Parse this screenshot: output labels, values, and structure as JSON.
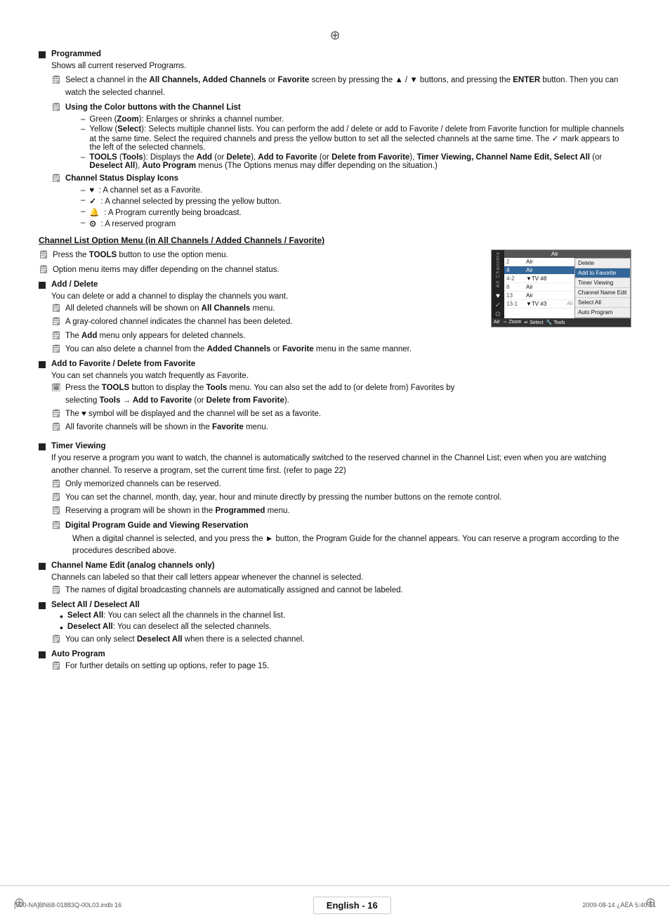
{
  "page": {
    "top_symbol": "⊕",
    "footer": {
      "left": "[500-NA]BN68-01883Q-00L03.indb   16",
      "center": "English - 16",
      "right": "2009-08-14   ¿ÁÈÀ 5:40:51"
    }
  },
  "sections": [
    {
      "id": "programmed",
      "bullet": true,
      "title": "Programmed",
      "body_lines": [
        "Shows all current reserved Programs."
      ],
      "notes": [
        "Select a channel in the <b>All Channels, Added Channels</b> or <b>Favorite</b> screen by pressing the ▲ / ▼ buttons, and pressing the <b>ENTER</b> button. Then you can watch the selected channel."
      ],
      "subsections": [
        {
          "title": "Using the Color buttons with the Channel List",
          "items": [
            "Green (<b>Zoom</b>): Enlarges or shrinks a channel number.",
            "Yellow (<b>Select</b>): Selects multiple channel lists. You can perform the add / delete or add to Favorite / delete from Favorite function for multiple channels at the same time. Select the required channels and press the yellow button to set all the selected channels at the same time. The ✓ mark appears to the left of the selected channels.",
            "<b>TOOLS</b> (<b>Tools</b>): Displays the <b>Add</b> (or <b>Delete</b>), <b>Add to Favorite</b> (or <b>Delete from Favorite</b>), <b>Timer Viewing, Channel Name Edit, Select All</b> (or <b>Deselect All</b>), <b>Auto Program</b> menus (The Options menus may differ depending on the situation.)"
          ]
        },
        {
          "title": "Channel Status Display Icons",
          "items": [
            "♥ : A channel set as a Favorite.",
            "✓ : A channel selected by pressing the yellow button.",
            "🔔 : A Program currently being broadcast.",
            "⊙ : A reserved program"
          ]
        }
      ]
    }
  ],
  "channel_list_option": {
    "heading": "Channel List Option Menu (in All Channels / Added Channels / Favorite)",
    "notes": [
      "Press the <b>TOOLS</b> button to use the option menu.",
      "Option menu items may differ depending on the channel status."
    ],
    "subsections": [
      {
        "id": "add-delete",
        "bullet": true,
        "title": "Add / Delete",
        "body": "You can delete or add a channel to display the channels you want.",
        "notes": [
          "All deleted channels will be shown on <b>All Channels</b> menu.",
          "A gray-colored channel indicates the channel has been deleted.",
          "The <b>Add</b> menu only appears for deleted channels.",
          "You can also delete a channel from the <b>Added Channels</b> or <b>Favorite</b> menu in the same manner."
        ]
      },
      {
        "id": "add-favorite",
        "bullet": true,
        "title": "Add to Favorite / Delete from Favorite",
        "body": "You can set channels you watch frequently as Favorite.",
        "notes": [
          "Press the <b>TOOLS</b> button to display the <b>Tools</b> menu. You can also set the add to (or delete from) Favorites by selecting <b>Tools → Add to Favorite</b> (or <b>Delete from Favorite</b>).",
          "The ♥ symbol will be displayed and the channel will be set as a favorite.",
          "All favorite channels will be shown in the <b>Favorite</b> menu."
        ]
      },
      {
        "id": "timer-viewing",
        "bullet": true,
        "title": "Timer Viewing",
        "body": "If you reserve a program you want to watch, the channel is automatically switched to the reserved channel in the Channel List; even when you are watching another channel. To reserve a program, set the current time first. (refer to page 22)",
        "notes": [
          "Only memorized channels can be reserved.",
          "You can set the channel, month, day, year, hour and minute directly by pressing the number buttons on the remote control.",
          "Reserving a program will be shown in the <b>Programmed</b> menu."
        ],
        "subsubsections": [
          {
            "title": "Digital Program Guide and Viewing Reservation",
            "body": "When a digital channel is selected, and you press the ► button, the Program Guide for the channel appears. You can reserve a program according to the procedures described above."
          }
        ]
      },
      {
        "id": "channel-name-edit",
        "bullet": true,
        "title": "Channel Name Edit (analog channels only)",
        "body": "Channels can labeled so that their call letters appear whenever the channel is selected.",
        "notes": [
          "The names of digital broadcasting channels are automatically assigned and cannot be labeled."
        ]
      },
      {
        "id": "select-all",
        "bullet": true,
        "title": "Select All / Deselect All",
        "bullet_items": [
          "<b>Select All</b>: You can select all the channels in the channel list.",
          "<b>Deselect All</b>: You can deselect all the selected channels."
        ],
        "notes": [
          "You can only select <b>Deselect All</b> when there is a selected channel."
        ]
      },
      {
        "id": "auto-program",
        "bullet": true,
        "title": "Auto Program",
        "notes": [
          "For further details on setting up options, refer to page 15."
        ]
      }
    ]
  },
  "channel_ui": {
    "sidebar_label": "All Channels",
    "rows": [
      {
        "num": "2",
        "type": "Air",
        "selected": false
      },
      {
        "num": "4",
        "type": "Air",
        "selected": true
      },
      {
        "num": "4-2",
        "type": "▼TV #8",
        "selected": false
      },
      {
        "num": "8",
        "type": "Air",
        "selected": false
      },
      {
        "num": "13",
        "type": "Air",
        "selected": false
      },
      {
        "num": "13-1",
        "type": "▼TV #3",
        "selected": false
      }
    ],
    "header_col3": "All",
    "context_menu_items": [
      {
        "label": "Delete",
        "active": false
      },
      {
        "label": "Add to Favorite",
        "active": true
      },
      {
        "label": "Timer Viewing",
        "active": false
      },
      {
        "label": "Channel Name Edit",
        "active": false
      },
      {
        "label": "Select All",
        "active": false
      },
      {
        "label": "Auto Program",
        "active": false
      }
    ],
    "bottom_bar": [
      {
        "key": "Air",
        "label": ""
      },
      {
        "key": "⇔",
        "label": "Zoom"
      },
      {
        "key": "↵",
        "label": "Select"
      },
      {
        "key": "🔧",
        "label": "Tools"
      }
    ]
  }
}
